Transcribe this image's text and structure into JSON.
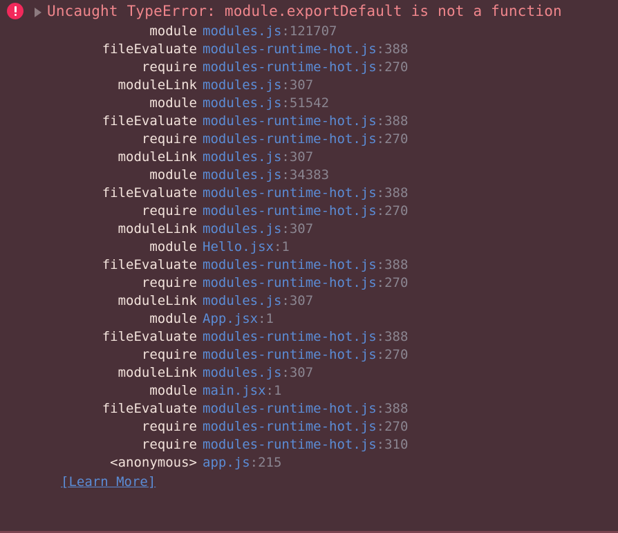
{
  "overlay": {
    "background_color": "#4a3038",
    "title": "Uncaught TypeError: module.exportDefault is not a function",
    "title_color": "#f0868c",
    "badge_color": "#f2295b",
    "link_color": "#5b8cd6",
    "function_color": "#f3e3dc",
    "line_number_color": "#8b8590",
    "icons": {
      "error": "error-exclamation-icon",
      "disclosure": "disclosure-triangle-right-icon"
    }
  },
  "stack": [
    {
      "fn": "module",
      "file": "modules.js",
      "line": ":121707"
    },
    {
      "fn": "fileEvaluate",
      "file": "modules-runtime-hot.js",
      "line": ":388"
    },
    {
      "fn": "require",
      "file": "modules-runtime-hot.js",
      "line": ":270"
    },
    {
      "fn": "moduleLink",
      "file": "modules.js",
      "line": ":307"
    },
    {
      "fn": "module",
      "file": "modules.js",
      "line": ":51542"
    },
    {
      "fn": "fileEvaluate",
      "file": "modules-runtime-hot.js",
      "line": ":388"
    },
    {
      "fn": "require",
      "file": "modules-runtime-hot.js",
      "line": ":270"
    },
    {
      "fn": "moduleLink",
      "file": "modules.js",
      "line": ":307"
    },
    {
      "fn": "module",
      "file": "modules.js",
      "line": ":34383"
    },
    {
      "fn": "fileEvaluate",
      "file": "modules-runtime-hot.js",
      "line": ":388"
    },
    {
      "fn": "require",
      "file": "modules-runtime-hot.js",
      "line": ":270"
    },
    {
      "fn": "moduleLink",
      "file": "modules.js",
      "line": ":307"
    },
    {
      "fn": "module",
      "file": "Hello.jsx",
      "line": ":1"
    },
    {
      "fn": "fileEvaluate",
      "file": "modules-runtime-hot.js",
      "line": ":388"
    },
    {
      "fn": "require",
      "file": "modules-runtime-hot.js",
      "line": ":270"
    },
    {
      "fn": "moduleLink",
      "file": "modules.js",
      "line": ":307"
    },
    {
      "fn": "module",
      "file": "App.jsx",
      "line": ":1"
    },
    {
      "fn": "fileEvaluate",
      "file": "modules-runtime-hot.js",
      "line": ":388"
    },
    {
      "fn": "require",
      "file": "modules-runtime-hot.js",
      "line": ":270"
    },
    {
      "fn": "moduleLink",
      "file": "modules.js",
      "line": ":307"
    },
    {
      "fn": "module",
      "file": "main.jsx",
      "line": ":1"
    },
    {
      "fn": "fileEvaluate",
      "file": "modules-runtime-hot.js",
      "line": ":388"
    },
    {
      "fn": "require",
      "file": "modules-runtime-hot.js",
      "line": ":270"
    },
    {
      "fn": "require",
      "file": "modules-runtime-hot.js",
      "line": ":310"
    },
    {
      "fn": "<anonymous>",
      "file": "app.js",
      "line": ":215"
    }
  ],
  "footer": {
    "learn_more_label": "[Learn More]"
  }
}
